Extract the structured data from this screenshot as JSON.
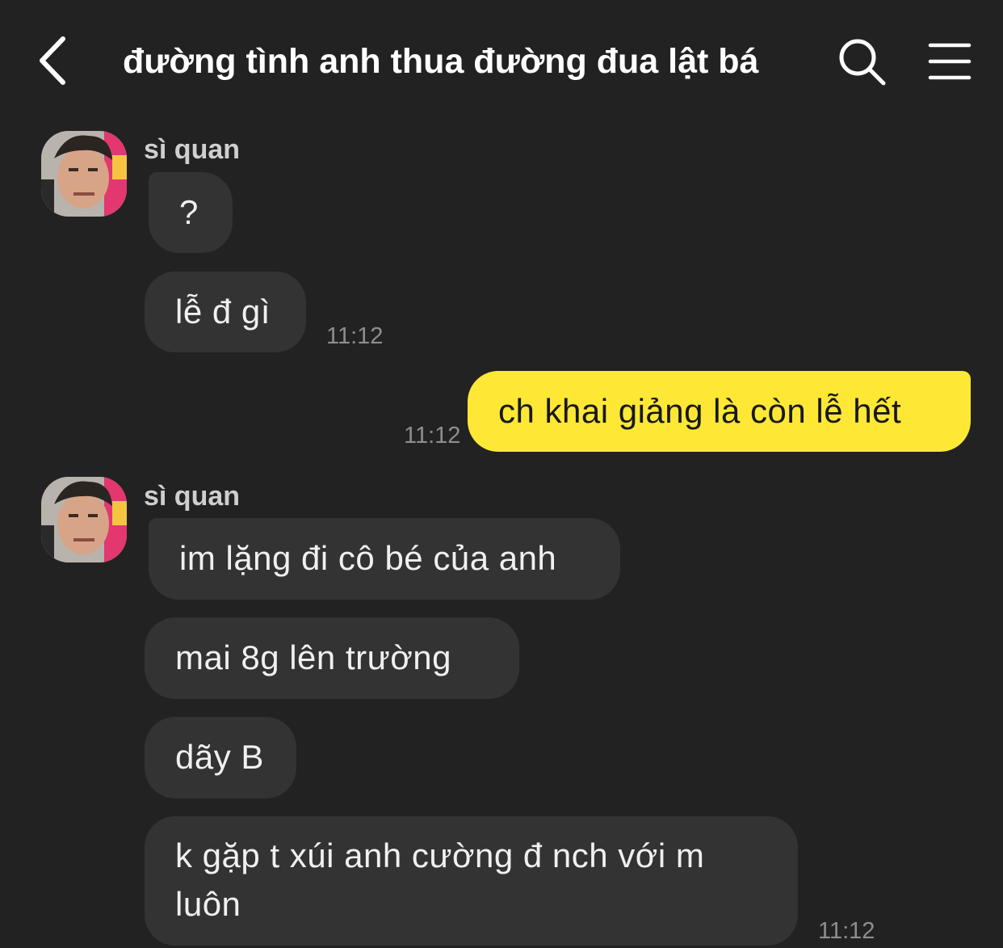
{
  "header": {
    "title": "đường tình anh thua đường đua lật bá",
    "back_icon": "chevron-left-icon",
    "search_icon": "search-icon",
    "menu_icon": "hamburger-menu-icon"
  },
  "colors": {
    "background": "#222222",
    "incoming_bubble": "#333333",
    "outgoing_bubble": "#fee835",
    "timestamp": "#8e8e8e"
  },
  "messages": {
    "group1": {
      "sender": "sì quan",
      "m1": "?",
      "m2": "lễ đ gì",
      "time": "11:12"
    },
    "outgoing": {
      "text": "ch khai giảng là còn lễ hết",
      "time": "11:12"
    },
    "group2": {
      "sender": "sì quan",
      "m1": "im lặng đi cô bé của anh",
      "m2": "mai 8g lên trường",
      "m3": "dãy B",
      "m4": "k gặp t xúi anh cường đ nch với m luôn",
      "time": "11:12"
    }
  }
}
